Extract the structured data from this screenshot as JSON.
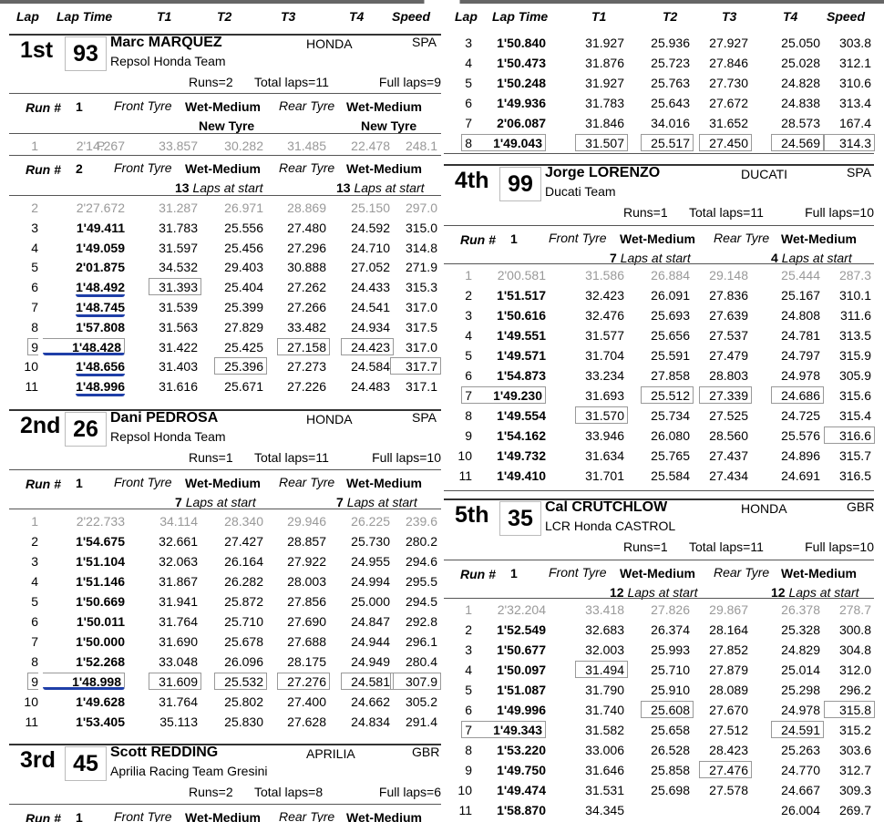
{
  "columns": {
    "lap": "Lap",
    "lap_time": "Lap Time",
    "t1": "T1",
    "t2": "T2",
    "t3": "T3",
    "t4": "T4",
    "speed": "Speed"
  },
  "labels": {
    "run": "Run #",
    "front_tyre": "Front Tyre",
    "rear_tyre": "Rear Tyre",
    "laps_at_start": "Laps at start"
  },
  "riders": [
    {
      "position": "1st",
      "number": "93",
      "name": "Marc MARQUEZ",
      "team": "Repsol Honda Team",
      "make": "HONDA",
      "nation": "SPA",
      "runs": "Runs=2",
      "total_laps": "Total laps=11",
      "full_laps": "Full laps=9"
    },
    {
      "position": "2nd",
      "number": "26",
      "name": "Dani PEDROSA",
      "team": "Repsol Honda Team",
      "make": "HONDA",
      "nation": "SPA",
      "runs": "Runs=1",
      "total_laps": "Total laps=11",
      "full_laps": "Full laps=10"
    },
    {
      "position": "3rd",
      "number": "45",
      "name": "Scott REDDING",
      "team": "Aprilia Racing Team Gresini",
      "make": "APRILIA",
      "nation": "GBR",
      "runs": "Runs=2",
      "total_laps": "Total laps=8",
      "full_laps": "Full laps=6"
    },
    {
      "position": "4th",
      "number": "99",
      "name": "Jorge LORENZO",
      "team": "Ducati Team",
      "make": "DUCATI",
      "nation": "SPA",
      "runs": "Runs=1",
      "total_laps": "Total laps=11",
      "full_laps": "Full laps=10"
    },
    {
      "position": "5th",
      "number": "35",
      "name": "Cal CRUTCHLOW",
      "team": "LCR Honda CASTROL",
      "make": "HONDA",
      "nation": "GBR",
      "runs": "Runs=1",
      "total_laps": "Total laps=11",
      "full_laps": "Full laps=10"
    }
  ],
  "runs": {
    "r1_1": {
      "run": "1",
      "front": "Wet-Medium",
      "rear": "Wet-Medium",
      "front_note": "New Tyre",
      "rear_note": "New Tyre"
    },
    "r1_2": {
      "run": "2",
      "front": "Wet-Medium",
      "rear": "Wet-Medium",
      "front_laps": "13",
      "rear_laps": "13"
    },
    "r2_1": {
      "run": "1",
      "front": "Wet-Medium",
      "rear": "Wet-Medium",
      "front_laps": "7",
      "rear_laps": "7"
    },
    "r3_1": {
      "run": "1",
      "front": "Wet-Medium",
      "rear": "Wet-Medium"
    },
    "r4_1": {
      "run": "1",
      "front": "Wet-Medium",
      "rear": "Wet-Medium",
      "front_laps": "7",
      "rear_laps": "4"
    },
    "r5_1": {
      "run": "1",
      "front": "Wet-Medium",
      "rear": "Wet-Medium",
      "front_laps": "12",
      "rear_laps": "12"
    }
  },
  "laps": {
    "r1_1": [
      {
        "lap": "1",
        "time": "2'14.267",
        "flag": "P",
        "t1": "33.857",
        "t2": "30.282",
        "t3": "31.485",
        "t4": "22.478",
        "speed": "248.1",
        "grey": true
      }
    ],
    "r1_2": [
      {
        "lap": "2",
        "time": "2'27.672",
        "t1": "31.287",
        "t2": "26.971",
        "t3": "28.869",
        "t4": "25.150",
        "speed": "297.0",
        "grey": true
      },
      {
        "lap": "3",
        "time": "1'49.411",
        "t1": "31.783",
        "t2": "25.556",
        "t3": "27.480",
        "t4": "24.592",
        "speed": "315.0"
      },
      {
        "lap": "4",
        "time": "1'49.059",
        "t1": "31.597",
        "t2": "25.456",
        "t3": "27.296",
        "t4": "24.710",
        "speed": "314.8"
      },
      {
        "lap": "5",
        "time": "2'01.875",
        "t1": "34.532",
        "t2": "29.403",
        "t3": "30.888",
        "t4": "27.052",
        "speed": "271.9"
      },
      {
        "lap": "6",
        "time": "1'48.492",
        "t1": "31.393",
        "t2": "25.404",
        "t3": "27.262",
        "t4": "24.433",
        "speed": "315.3",
        "u": true,
        "b1": true
      },
      {
        "lap": "7",
        "time": "1'48.745",
        "t1": "31.539",
        "t2": "25.399",
        "t3": "27.266",
        "t4": "24.541",
        "speed": "317.0",
        "u": true
      },
      {
        "lap": "8",
        "time": "1'57.808",
        "t1": "31.563",
        "t2": "27.829",
        "t3": "33.482",
        "t4": "24.934",
        "speed": "317.5"
      },
      {
        "lap": "9",
        "time": "1'48.428",
        "t1": "31.422",
        "t2": "25.425",
        "t3": "27.158",
        "t4": "24.423",
        "speed": "317.0",
        "u": true,
        "bt": true,
        "b3": true,
        "b4": true
      },
      {
        "lap": "10",
        "time": "1'48.656",
        "t1": "31.403",
        "t2": "25.396",
        "t3": "27.273",
        "t4": "24.584",
        "speed": "317.7",
        "u": true,
        "b2": true,
        "bs": true
      },
      {
        "lap": "11",
        "time": "1'48.996",
        "t1": "31.616",
        "t2": "25.671",
        "t3": "27.226",
        "t4": "24.483",
        "speed": "317.1",
        "u": true
      }
    ],
    "r2_1": [
      {
        "lap": "1",
        "time": "2'22.733",
        "t1": "34.114",
        "t2": "28.340",
        "t3": "29.946",
        "t4": "26.225",
        "speed": "239.6",
        "grey": true
      },
      {
        "lap": "2",
        "time": "1'54.675",
        "t1": "32.661",
        "t2": "27.427",
        "t3": "28.857",
        "t4": "25.730",
        "speed": "280.2"
      },
      {
        "lap": "3",
        "time": "1'51.104",
        "t1": "32.063",
        "t2": "26.164",
        "t3": "27.922",
        "t4": "24.955",
        "speed": "294.6"
      },
      {
        "lap": "4",
        "time": "1'51.146",
        "t1": "31.867",
        "t2": "26.282",
        "t3": "28.003",
        "t4": "24.994",
        "speed": "295.5"
      },
      {
        "lap": "5",
        "time": "1'50.669",
        "t1": "31.941",
        "t2": "25.872",
        "t3": "27.856",
        "t4": "25.000",
        "speed": "294.5"
      },
      {
        "lap": "6",
        "time": "1'50.011",
        "t1": "31.764",
        "t2": "25.710",
        "t3": "27.690",
        "t4": "24.847",
        "speed": "292.8"
      },
      {
        "lap": "7",
        "time": "1'50.000",
        "t1": "31.690",
        "t2": "25.678",
        "t3": "27.688",
        "t4": "24.944",
        "speed": "296.1"
      },
      {
        "lap": "8",
        "time": "1'52.268",
        "t1": "33.048",
        "t2": "26.096",
        "t3": "28.175",
        "t4": "24.949",
        "speed": "280.4"
      },
      {
        "lap": "9",
        "time": "1'48.998",
        "t1": "31.609",
        "t2": "25.532",
        "t3": "27.276",
        "t4": "24.581",
        "speed": "307.9",
        "u": true,
        "bt": true,
        "b1": true,
        "b2": true,
        "b3": true,
        "b4": true,
        "bs": true
      },
      {
        "lap": "10",
        "time": "1'49.628",
        "t1": "31.764",
        "t2": "25.802",
        "t3": "27.400",
        "t4": "24.662",
        "speed": "305.2"
      },
      {
        "lap": "11",
        "time": "1'53.405",
        "t1": "35.113",
        "t2": "25.830",
        "t3": "27.628",
        "t4": "24.834",
        "speed": "291.4"
      }
    ],
    "r3_2": [
      {
        "lap": "3",
        "time": "1'50.840",
        "t1": "31.927",
        "t2": "25.936",
        "t3": "27.927",
        "t4": "25.050",
        "speed": "303.8"
      },
      {
        "lap": "4",
        "time": "1'50.473",
        "t1": "31.876",
        "t2": "25.723",
        "t3": "27.846",
        "t4": "25.028",
        "speed": "312.1"
      },
      {
        "lap": "5",
        "time": "1'50.248",
        "t1": "31.927",
        "t2": "25.763",
        "t3": "27.730",
        "t4": "24.828",
        "speed": "310.6"
      },
      {
        "lap": "6",
        "time": "1'49.936",
        "t1": "31.783",
        "t2": "25.643",
        "t3": "27.672",
        "t4": "24.838",
        "speed": "313.4"
      },
      {
        "lap": "7",
        "time": "2'06.087",
        "t1": "31.846",
        "t2": "34.016",
        "t3": "31.652",
        "t4": "28.573",
        "speed": "167.4"
      },
      {
        "lap": "8",
        "time": "1'49.043",
        "t1": "31.507",
        "t2": "25.517",
        "t3": "27.450",
        "t4": "24.569",
        "speed": "314.3",
        "bt": true,
        "b1": true,
        "b2": true,
        "b3": true,
        "b4": true,
        "bs": true
      }
    ],
    "r4_1": [
      {
        "lap": "1",
        "time": "2'00.581",
        "t1": "31.586",
        "t2": "26.884",
        "t3": "29.148",
        "t4": "25.444",
        "speed": "287.3",
        "grey": true
      },
      {
        "lap": "2",
        "time": "1'51.517",
        "t1": "32.423",
        "t2": "26.091",
        "t3": "27.836",
        "t4": "25.167",
        "speed": "310.1"
      },
      {
        "lap": "3",
        "time": "1'50.616",
        "t1": "32.476",
        "t2": "25.693",
        "t3": "27.639",
        "t4": "24.808",
        "speed": "311.6"
      },
      {
        "lap": "4",
        "time": "1'49.551",
        "t1": "31.577",
        "t2": "25.656",
        "t3": "27.537",
        "t4": "24.781",
        "speed": "313.5"
      },
      {
        "lap": "5",
        "time": "1'49.571",
        "t1": "31.704",
        "t2": "25.591",
        "t3": "27.479",
        "t4": "24.797",
        "speed": "315.9"
      },
      {
        "lap": "6",
        "time": "1'54.873",
        "t1": "33.234",
        "t2": "27.858",
        "t3": "28.803",
        "t4": "24.978",
        "speed": "305.9"
      },
      {
        "lap": "7",
        "time": "1'49.230",
        "t1": "31.693",
        "t2": "25.512",
        "t3": "27.339",
        "t4": "24.686",
        "speed": "315.6",
        "bt": true,
        "b2": true,
        "b3": true,
        "b4": true
      },
      {
        "lap": "8",
        "time": "1'49.554",
        "t1": "31.570",
        "t2": "25.734",
        "t3": "27.525",
        "t4": "24.725",
        "speed": "315.4",
        "b1": true
      },
      {
        "lap": "9",
        "time": "1'54.162",
        "t1": "33.946",
        "t2": "26.080",
        "t3": "28.560",
        "t4": "25.576",
        "speed": "316.6",
        "bs": true
      },
      {
        "lap": "10",
        "time": "1'49.732",
        "t1": "31.634",
        "t2": "25.765",
        "t3": "27.437",
        "t4": "24.896",
        "speed": "315.7"
      },
      {
        "lap": "11",
        "time": "1'49.410",
        "t1": "31.701",
        "t2": "25.584",
        "t3": "27.434",
        "t4": "24.691",
        "speed": "316.5"
      }
    ],
    "r5_1": [
      {
        "lap": "1",
        "time": "2'32.204",
        "t1": "33.418",
        "t2": "27.826",
        "t3": "29.867",
        "t4": "26.378",
        "speed": "278.7",
        "grey": true
      },
      {
        "lap": "2",
        "time": "1'52.549",
        "t1": "32.683",
        "t2": "26.374",
        "t3": "28.164",
        "t4": "25.328",
        "speed": "300.8"
      },
      {
        "lap": "3",
        "time": "1'50.677",
        "t1": "32.003",
        "t2": "25.993",
        "t3": "27.852",
        "t4": "24.829",
        "speed": "304.8"
      },
      {
        "lap": "4",
        "time": "1'50.097",
        "t1": "31.494",
        "t2": "25.710",
        "t3": "27.879",
        "t4": "25.014",
        "speed": "312.0",
        "b1": true
      },
      {
        "lap": "5",
        "time": "1'51.087",
        "t1": "31.790",
        "t2": "25.910",
        "t3": "28.089",
        "t4": "25.298",
        "speed": "296.2"
      },
      {
        "lap": "6",
        "time": "1'49.996",
        "t1": "31.740",
        "t2": "25.608",
        "t3": "27.670",
        "t4": "24.978",
        "speed": "315.8",
        "b2": true,
        "bs": true
      },
      {
        "lap": "7",
        "time": "1'49.343",
        "t1": "31.582",
        "t2": "25.658",
        "t3": "27.512",
        "t4": "24.591",
        "speed": "315.2",
        "bt": true,
        "b4": true
      },
      {
        "lap": "8",
        "time": "1'53.220",
        "t1": "33.006",
        "t2": "26.528",
        "t3": "28.423",
        "t4": "25.263",
        "speed": "303.6"
      },
      {
        "lap": "9",
        "time": "1'49.750",
        "t1": "31.646",
        "t2": "25.858",
        "t3": "27.476",
        "t4": "24.770",
        "speed": "312.7",
        "b3": true
      },
      {
        "lap": "10",
        "time": "1'49.474",
        "t1": "31.531",
        "t2": "25.698",
        "t3": "27.578",
        "t4": "24.667",
        "speed": "309.3"
      },
      {
        "lap": "11",
        "time": "1'58.870",
        "t1": "34.345",
        "t2": "",
        "t3": "",
        "t4": "26.004",
        "speed": "269.7"
      }
    ]
  },
  "colors": {
    "underline": "#1f3fa8",
    "grey_text": "#999999",
    "box_border": "#999999"
  }
}
